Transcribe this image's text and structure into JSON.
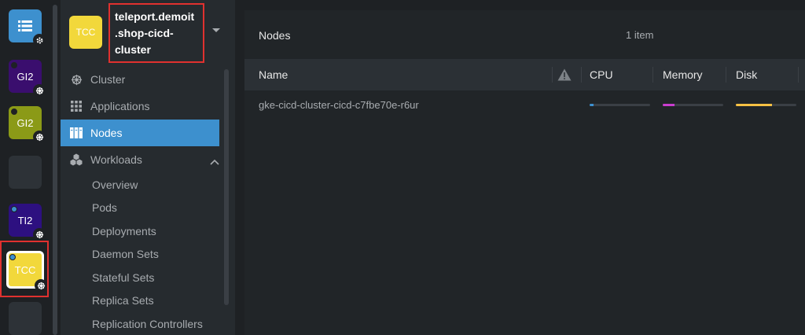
{
  "colors": {
    "accent": "#3d90ce",
    "highlight_red": "#e0312f",
    "cpu_bar": "#3d90ce",
    "memory_bar": "#c93dce",
    "disk_bar": "#f6c143"
  },
  "hotbar": {
    "items": [
      {
        "label": "",
        "icon": "catalog-icon",
        "bg": "#3d90ce",
        "badge": "gear-icon"
      },
      {
        "label": "GI2",
        "bg": "#3a0e6e",
        "dot": "#1e2124",
        "badge": "kube-icon"
      },
      {
        "label": "GI2",
        "bg": "#8b9a17",
        "dot": "#1e2124",
        "badge": "kube-icon"
      },
      {
        "label": "",
        "bg": "#2d3237"
      },
      {
        "label": "TI2",
        "bg": "#2d1080",
        "dot": "#3d90ce",
        "badge": "kube-icon"
      },
      {
        "label": "TCC",
        "bg": "#f2d83b",
        "dot": "#3d90ce",
        "badge": "kube-icon",
        "active": true
      },
      {
        "label": "",
        "bg": "#2d3237"
      }
    ]
  },
  "cluster": {
    "icon_label": "TCC",
    "name_lines": [
      "teleport.demoit",
      ".shop-cicd-",
      "cluster"
    ]
  },
  "nav": {
    "cluster": "Cluster",
    "applications": "Applications",
    "nodes": "Nodes",
    "workloads": "Workloads",
    "sub": [
      "Overview",
      "Pods",
      "Deployments",
      "Daemon Sets",
      "Stateful Sets",
      "Replica Sets",
      "Replication Controllers"
    ]
  },
  "main": {
    "title": "Nodes",
    "count": "1 item",
    "columns": {
      "name": "Name",
      "cpu": "CPU",
      "memory": "Memory",
      "disk": "Disk"
    },
    "rows": [
      {
        "name": "gke-cicd-cluster-cicd-c7fbe70e-r6ur",
        "cpu": 0.06,
        "memory": 0.2,
        "disk": 0.6
      }
    ]
  }
}
